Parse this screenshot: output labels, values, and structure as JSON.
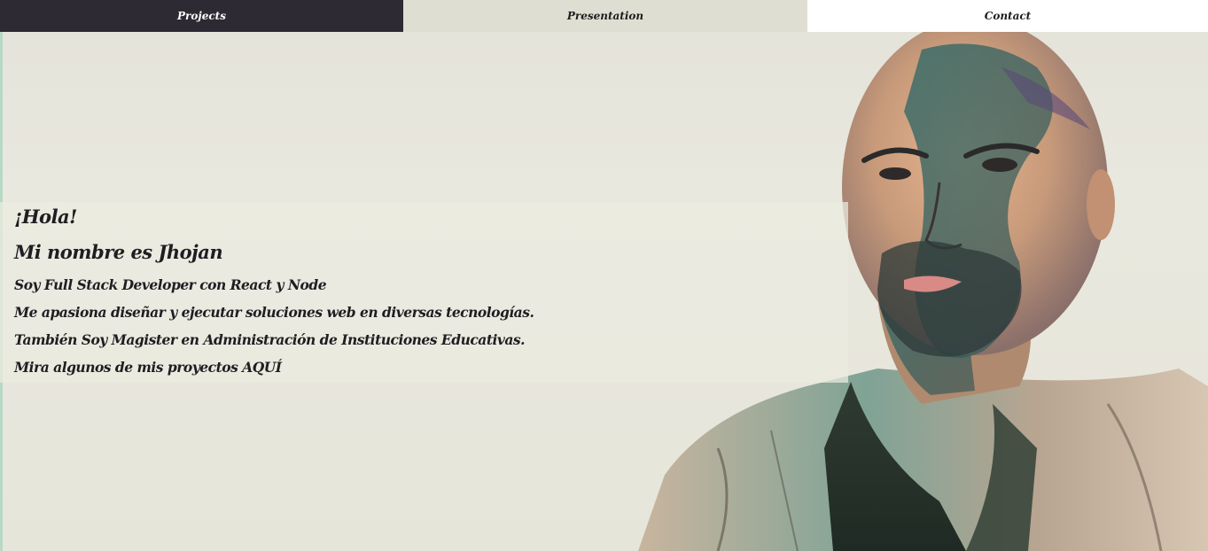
{
  "nav": {
    "projects": "Projects",
    "presentation": "Presentation",
    "contact": "Contact"
  },
  "intro": {
    "greeting": "¡Hola!",
    "name_line": "Mi nombre es Jhojan",
    "line1": "Soy Full Stack Developer con React y Node",
    "line2": "Me apasiona diseñar y ejecutar soluciones web en diversas tecnologías.",
    "line3": "También Soy Magister en Administración de Instituciones Educativas.",
    "line4_prefix": "Mira algunos de mis proyectos ",
    "line4_link": "AQUÍ"
  },
  "colors": {
    "nav_active": "#2d2a33",
    "nav_mid": "#dedfd2",
    "nav_light": "#ffffff",
    "background": "#e6e5da",
    "text": "#1e1e22"
  }
}
